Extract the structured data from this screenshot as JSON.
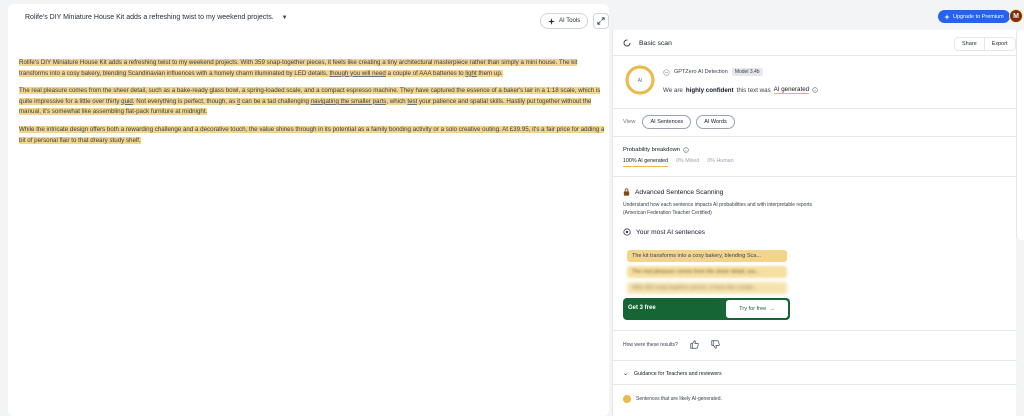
{
  "editor": {
    "title": "Rolife's DIY Miniature House Kit adds a refreshing twist to my weekend projects.",
    "ai_tools_label": "AI Tools",
    "paragraphs": [
      [
        {
          "t": "Rolife's DIY Miniature House Kit adds a refreshing twist to my weekend projects. With 359 snap-together pieces, it feels like creating a tiny architectural masterpiece rather than simply a mini house. The kit transforms into a cosy bakery, blending Scandinavian influences with a homely charm illuminated by LED details, "
        },
        {
          "t": "though you will need",
          "u": true
        },
        {
          "t": " a couple of AAA batteries to "
        },
        {
          "t": "light",
          "u": true
        },
        {
          "t": " them up."
        }
      ],
      [
        {
          "t": "The real pleasure comes from the sheer detail, such as a bake-ready glass bowl, a spring-loaded scale, and a compact espresso machine. They have captured the essence of a baker's lair in a 1:18 scale, which is quite impressive for a little over thirty "
        },
        {
          "t": "quid",
          "u": true
        },
        {
          "t": ". Not everything is perfect, though, as "
        },
        {
          "t": "it",
          "u": true
        },
        {
          "t": " can be a tad challenging "
        },
        {
          "t": "navigating the smaller parts",
          "u": true
        },
        {
          "t": ", which "
        },
        {
          "t": "test",
          "u": true
        },
        {
          "t": " your patience and spatial skills. Hastily put together without the manual, it's somewhat like assembling flat-pack furniture at midnight."
        }
      ],
      [
        {
          "t": "While the intricate design offers both a rewarding challenge and a decorative touch, the value shines through in its potential as a family bonding activity or a solo creative outing. At £39.95, it's a fair price for adding a bit of personal flair to that dreary study shelf."
        }
      ]
    ]
  },
  "topbar": {
    "upgrade_label": "Upgrade to Premium",
    "avatar_initial": "M"
  },
  "panel": {
    "scan_title": "Basic scan",
    "share_label": "Share",
    "export_label": "Export",
    "gauge_label": "AI",
    "gauge_fraction": 1.0,
    "detector_name": "GPTZero AI Detection",
    "model_badge": "Model 3.4b",
    "confidence_prefix": "We are",
    "confidence_level": "highly confident",
    "confidence_middle": "this text was",
    "confidence_result": "AI generated",
    "view_label": "View",
    "view_options": [
      "AI Sentences",
      "AI Words"
    ],
    "prob_title": "Probability breakdown",
    "prob_tabs": [
      "100% AI generated",
      "0% Mixed",
      "0% Human"
    ],
    "adv_title": "Advanced Sentence Scanning",
    "adv_desc": "Understand how each sentence impacts AI probabilities and with interpretable reports (American Federation Teacher Certified)",
    "mostai_title": "Your most AI sentences",
    "sentences": [
      "The kit transforms into a cosy bakery, blending Sca...",
      "The real pleasure comes from the sheer detail, suc...",
      "With 359 snap-together pieces, it feels like creatin..."
    ],
    "free_label": "Get 3 free",
    "try_label": "Try for free",
    "results_question": "How were these results?",
    "guidance_label": "Guidance for Teachers and reviewers",
    "legend_label": "Sentences that are likely AI-generated."
  },
  "colors": {
    "highlight": "#f2d58a",
    "accent": "#e9b949",
    "cta_green": "#166534",
    "upgrade_blue": "#2563eb"
  }
}
